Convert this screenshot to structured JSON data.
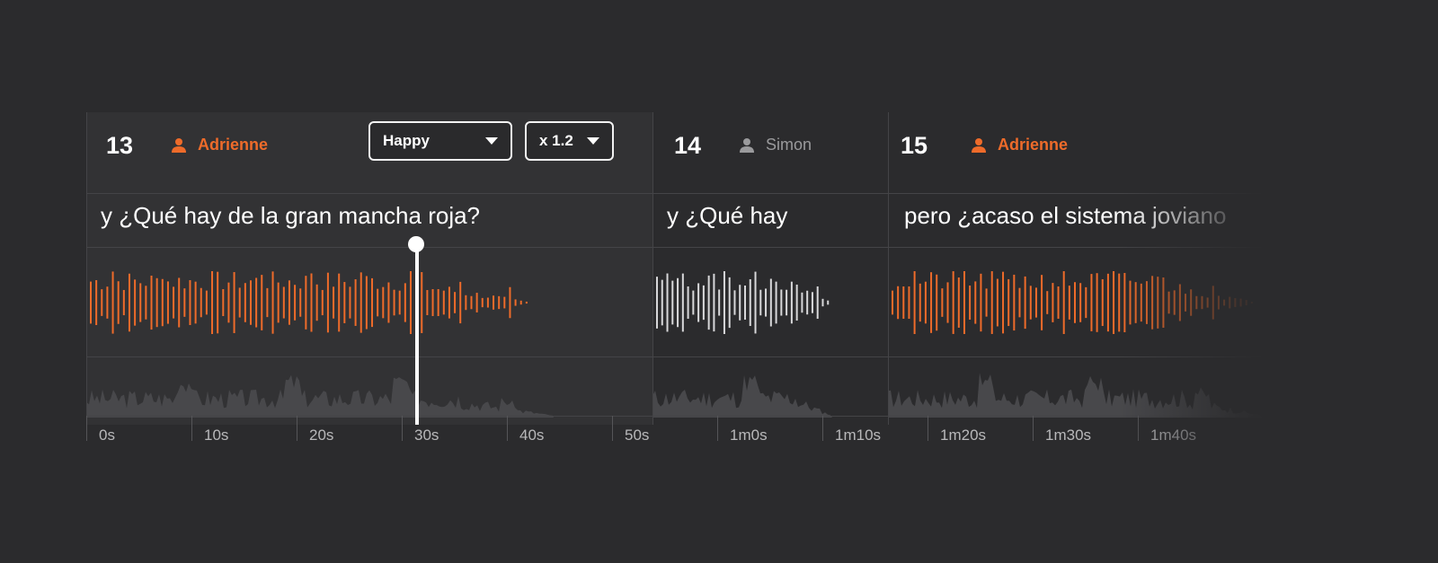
{
  "segments": [
    {
      "number": "13",
      "speaker": "Adrienne",
      "text": "y ¿Qué hay de la gran mancha roja?"
    },
    {
      "number": "14",
      "speaker": "Simon",
      "text": "y ¿Qué hay"
    },
    {
      "number": "15",
      "speaker": "Adrienne",
      "text": "pero ¿acaso el sistema joviano"
    }
  ],
  "emotion_dropdown": {
    "value": "Happy"
  },
  "speed_dropdown": {
    "value": "x 1.2"
  },
  "timeline": {
    "ticks": [
      "0s",
      "10s",
      "20s",
      "30s",
      "40s",
      "50s",
      "1m0s",
      "1m10s",
      "1m20s",
      "1m30s",
      "1m40s"
    ]
  },
  "colors": {
    "accent": "#ee6b2a",
    "inactive": "#9a9a9c",
    "background": "#2b2b2d"
  },
  "icons": {
    "speaker": "person-icon",
    "dropdown": "caret-down-icon"
  }
}
